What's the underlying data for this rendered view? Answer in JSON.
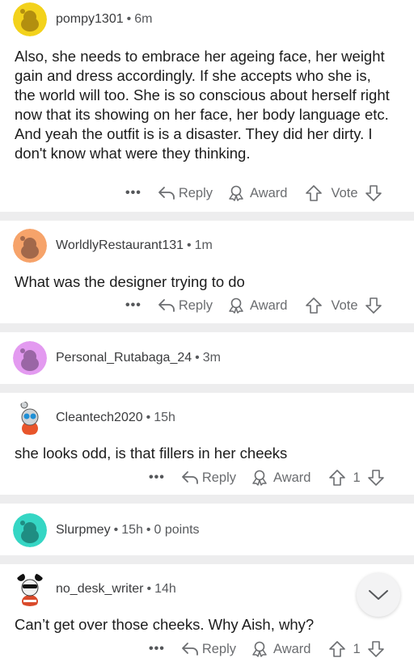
{
  "comments": [
    {
      "username": "pompy1301",
      "time": "6m",
      "body": "Also, she needs to embrace her ageing face, her weight gain and dress accordingly. If she accepts who she is, the world will too. She is so conscious about herself right now that its showing on her face, her body language etc. And yeah the outfit is is a disaster. They did her dirty. I don't know what were they thinking.",
      "reply_label": "Reply",
      "award_label": "Award",
      "vote_label": "Vote",
      "avatar_color": "#f3d21b"
    },
    {
      "username": "WorldlyRestaurant131",
      "time": "1m",
      "body": "What was the designer trying to do",
      "reply_label": "Reply",
      "award_label": "Award",
      "vote_label": "Vote",
      "avatar_color": "#f6a36a"
    },
    {
      "username": "Personal_Rutabaga_24",
      "time": "3m",
      "avatar_color": "#e39af0"
    },
    {
      "username": "Cleantech2020",
      "time": "15h",
      "body": "she looks odd, is that fillers in her cheeks",
      "reply_label": "Reply",
      "award_label": "Award",
      "vote_count": "1"
    },
    {
      "username": "Slurpmey",
      "time": "15h",
      "points": "0 points",
      "avatar_color": "#35d6c4"
    },
    {
      "username": "no_desk_writer",
      "time": "14h",
      "body": "Can’t get over those cheeks. Why Aish, why?",
      "reply_label": "Reply",
      "award_label": "Award",
      "vote_count": "1"
    }
  ],
  "more_label": "•••",
  "meta_separator": "•",
  "icons": {
    "reply": "reply-arrow-icon",
    "award": "award-icon",
    "upvote": "upvote-arrow-icon",
    "downvote": "downvote-arrow-icon",
    "scroll": "chevron-down-icon"
  }
}
